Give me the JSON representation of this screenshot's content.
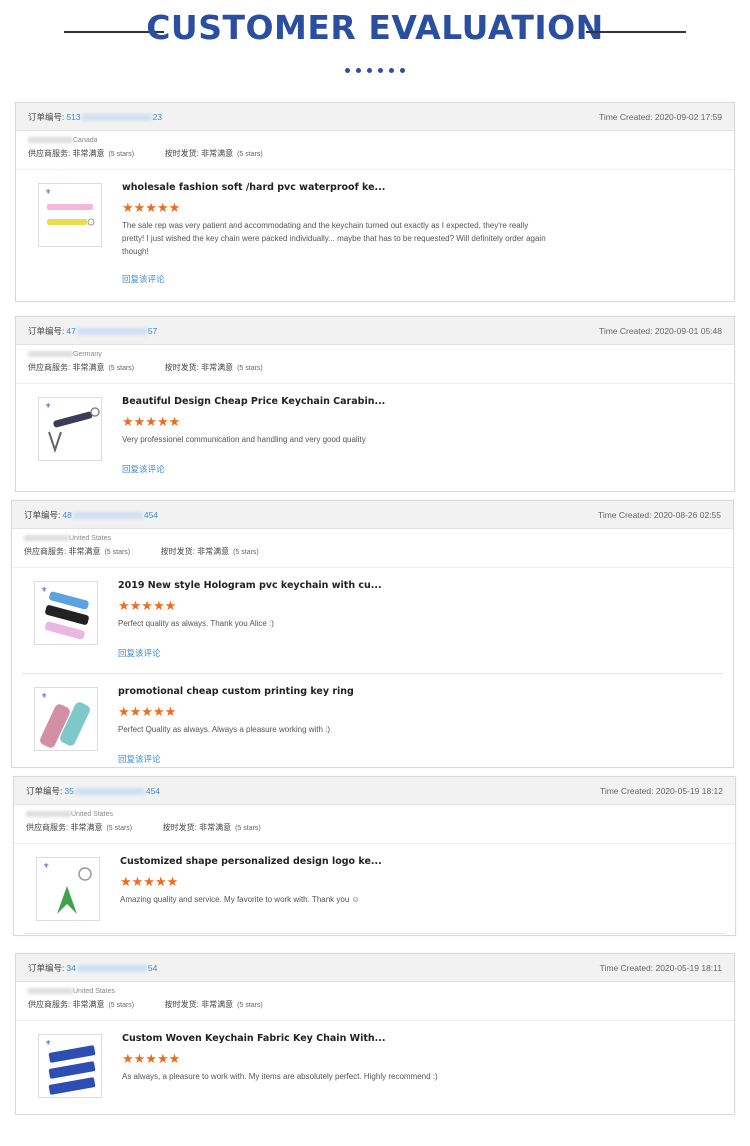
{
  "header": {
    "title": "CUSTOMER EVALUATION"
  },
  "labels": {
    "order_label": "订单编号:",
    "time_prefix": "Time Created:",
    "supplier_service": "供应商服务:",
    "on_time": "按时发货:",
    "very_satisfied": "非常满意",
    "stars5": "(5 stars)",
    "reply": "回复该评论",
    "star_glyphs": "★★★★★"
  },
  "orders": [
    {
      "order_prefix": "513",
      "order_suffix": "23",
      "time": "2020-09-02 17:59",
      "country": "Canada",
      "items": [
        {
          "name": "wholesale fashion soft /hard pvc waterproof ke...",
          "comment": "The sale rep was very patient and accommodating and the keychain turned out exactly as I expected, they're really pretty! I just wished the key chain were packed individually... maybe that has to be requested? Will definitely order again though!"
        }
      ]
    },
    {
      "order_prefix": "47",
      "order_suffix": "57",
      "time": "2020-09-01 05:48",
      "country": "Germany",
      "items": [
        {
          "name": "Beautiful Design Cheap Price Keychain Carabin...",
          "comment": "Very professionel communication and handling and very good quality"
        }
      ]
    },
    {
      "order_prefix": "48",
      "order_suffix": "454",
      "time": "2020-08-26 02:55",
      "country": "United States",
      "items": [
        {
          "name": "2019 New style Hologram pvc keychain with cu...",
          "comment": "Perfect quality as always. Thank you Alice :)"
        },
        {
          "name": "promotional cheap custom printing key ring",
          "comment": "Perfect Quality as always. Always a pleasure working with :)"
        }
      ]
    },
    {
      "order_prefix": "35",
      "order_suffix": "454",
      "time": "2020-05-19 18:12",
      "country": "United States",
      "items": [
        {
          "name": "Customized shape personalized design logo ke...",
          "comment": "Amazing quality and service. My favorite to work with. Thank you ☺"
        }
      ]
    },
    {
      "order_prefix": "34",
      "order_suffix": "54",
      "time": "2020-05-19 18:11",
      "country": "United States",
      "items": [
        {
          "name": "Custom Woven Keychain Fabric Key Chain With...",
          "comment": "As always, a pleasure to work with. My items are absolutely perfect. Highly recommend :)"
        }
      ]
    }
  ],
  "colors": {
    "accent": "#2b4fa0",
    "star": "#f26a1b",
    "link": "#3a8ad8"
  }
}
